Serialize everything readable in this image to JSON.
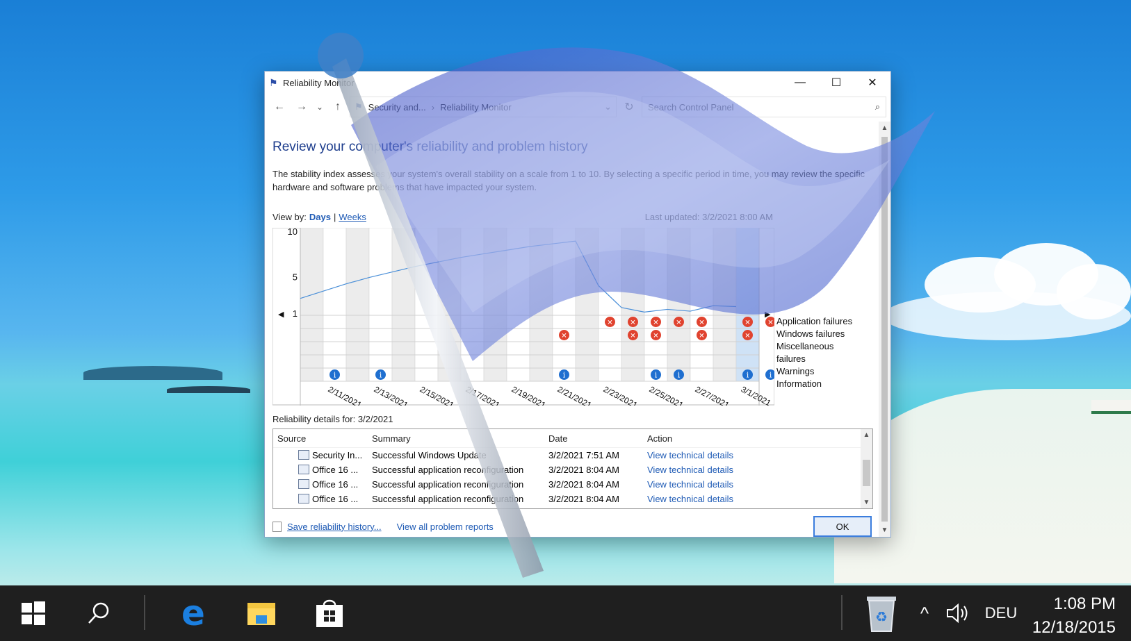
{
  "window": {
    "title": "Reliability Monitor",
    "minimize": "—",
    "maximize": "☐",
    "close": "✕"
  },
  "nav": {
    "back": "←",
    "forward": "→",
    "recent": "⌄",
    "up": "↑",
    "crumb_1": "Security and...",
    "crumb_sep": "›",
    "crumb_2": "Reliability Monitor",
    "refresh": "↻",
    "search_placeholder": "Search Control Panel",
    "search_icon": "magnifier-icon"
  },
  "page": {
    "heading": "Review your computer's reliability and problem history",
    "description": "The stability index assesses your system's overall stability on a scale from 1 to 10. By selecting a specific period in time, you may review the specific hardware and software problems that have impacted your system.",
    "view_by_label": "View by:",
    "view_days": "Days",
    "view_pipe": "|",
    "view_weeks": "Weeks",
    "last_updated": "Last updated: 3/2/2021 8:00 AM",
    "details_label": "Reliability details for: 3/2/2021"
  },
  "chart_data": {
    "type": "line",
    "y_ticks": [
      "10",
      "5",
      "1"
    ],
    "ylim": [
      1,
      10
    ],
    "x_labels": [
      "2/11/2021",
      "2/13/2021",
      "2/15/2021",
      "2/17/2021",
      "2/19/2021",
      "2/21/2021",
      "2/23/2021",
      "2/25/2021",
      "2/27/2021",
      "3/1/2021"
    ],
    "days": [
      "2/10",
      "2/11",
      "2/12",
      "2/13",
      "2/14",
      "2/15",
      "2/16",
      "2/17",
      "2/18",
      "2/19",
      "2/20",
      "2/21",
      "2/22",
      "2/23",
      "2/24",
      "2/25",
      "2/26",
      "2/27",
      "2/28",
      "3/1"
    ],
    "stability_index": [
      2.7,
      3.5,
      4.3,
      5.0,
      5.6,
      6.2,
      6.7,
      7.2,
      7.6,
      8.0,
      8.4,
      8.7,
      9.0,
      4.1,
      1.7,
      1.2,
      1.5,
      1.3,
      1.9,
      1.8
    ],
    "legend": [
      "Application failures",
      "Windows failures",
      "Miscellaneous failures",
      "Warnings",
      "Information"
    ],
    "application_failures_days": [
      13,
      14,
      15,
      16,
      17,
      19,
      20
    ],
    "windows_failures_days": [
      11,
      14,
      15,
      17,
      19
    ],
    "information_days": [
      1,
      3,
      11,
      15,
      16,
      19,
      20
    ],
    "grid": true,
    "colors": {
      "line": "#4a8fd8",
      "failure": "#e0432f",
      "info": "#1f6fd0"
    }
  },
  "details": {
    "columns": [
      "Source",
      "Summary",
      "Date",
      "Action"
    ],
    "rows": [
      {
        "source": "Security In...",
        "summary": "Successful Windows Update",
        "date": "3/2/2021 7:51 AM",
        "action": "View technical details"
      },
      {
        "source": "Office 16 ...",
        "summary": "Successful application reconfiguration",
        "date": "3/2/2021 8:04 AM",
        "action": "View technical details"
      },
      {
        "source": "Office 16 ...",
        "summary": "Successful application reconfiguration",
        "date": "3/2/2021 8:04 AM",
        "action": "View technical details"
      },
      {
        "source": "Office 16 ...",
        "summary": "Successful application reconfiguration",
        "date": "3/2/2021 8:04 AM",
        "action": "View technical details"
      }
    ]
  },
  "footer": {
    "save_link": "Save reliability history...",
    "reports_link": "View all problem reports",
    "ok": "OK"
  },
  "taskbar": {
    "language": "DEU",
    "time": "1:08 PM",
    "date": "12/18/2015",
    "chevron": "^"
  }
}
